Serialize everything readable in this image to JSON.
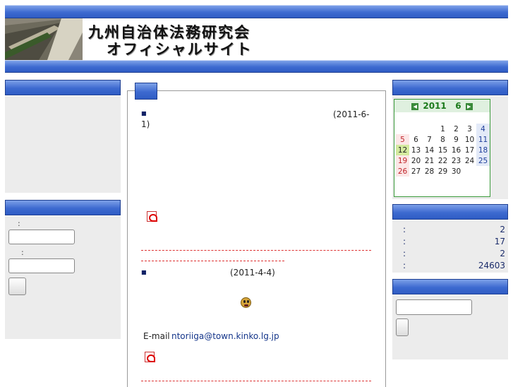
{
  "header": {
    "title_line1": "九州自治体法務研究会",
    "title_line2": "オフィシャルサイト"
  },
  "left": {
    "login_label1": ":",
    "login_label2": ":"
  },
  "news": [
    {
      "date": "(2011-6-",
      "date2": "1)"
    },
    {
      "date": "(2011-4-4)"
    }
  ],
  "contact": {
    "email_label": "E-mail",
    "email": "ntoriiga@town.kinko.lg.jp"
  },
  "calendar": {
    "year": "2011",
    "month": "6",
    "prev_icon": "left-arrow-icon",
    "next_icon": "right-arrow-icon",
    "weeks": [
      [
        "",
        "",
        "",
        "1",
        "2",
        "3",
        "4"
      ],
      [
        "5",
        "6",
        "7",
        "8",
        "9",
        "10",
        "11"
      ],
      [
        "12",
        "13",
        "14",
        "15",
        "16",
        "17",
        "18"
      ],
      [
        "19",
        "20",
        "21",
        "22",
        "23",
        "24",
        "25"
      ],
      [
        "26",
        "27",
        "28",
        "29",
        "30",
        "",
        ""
      ]
    ],
    "today": "12"
  },
  "stats": [
    {
      "colon": ":",
      "value": "2"
    },
    {
      "colon": ":",
      "value": "17"
    },
    {
      "colon": ":",
      "value": "2"
    },
    {
      "colon": ":",
      "value": "24603"
    }
  ],
  "colors": {
    "bar_blue": "#3d6ad0",
    "calendar_green": "#3a9a3a",
    "divider_red": "#dd3333"
  }
}
